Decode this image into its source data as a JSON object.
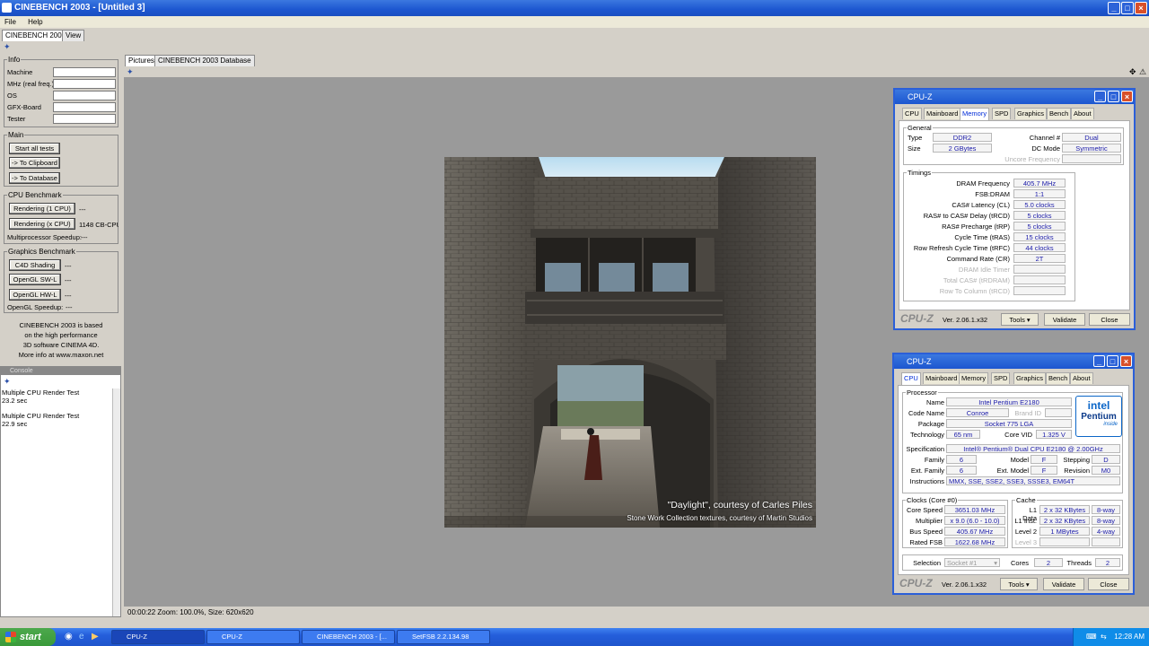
{
  "window": {
    "title": "CINEBENCH 2003 - [Untitled 3]"
  },
  "menu": {
    "file": "File",
    "help": "Help"
  },
  "tabs": {
    "main": "CINEBENCH 2003",
    "view": "View",
    "pictures": "Pictures",
    "database": "CINEBENCH 2003 Database"
  },
  "info": {
    "title": "Info",
    "machine": "Machine",
    "mhz": "MHz (real freq.)",
    "os": "OS",
    "gfx": "GFX-Board",
    "tester": "Tester"
  },
  "main": {
    "title": "Main",
    "start": "Start all tests",
    "clipboard": "-> To Clipboard",
    "database": "-> To Database"
  },
  "cpu_bench": {
    "title": "CPU Benchmark",
    "r1": "Rendering (1 CPU)",
    "r1_val": "---",
    "rx": "Rendering (x CPU)",
    "rx_val": "1148 CB-CPU",
    "speedup": "Multiprocessor Speedup:",
    "speedup_val": "---"
  },
  "gfx_bench": {
    "title": "Graphics Benchmark",
    "c4d": "C4D Shading",
    "c4d_val": "---",
    "sw": "OpenGL SW-L",
    "sw_val": "---",
    "hw": "OpenGL HW-L",
    "hw_val": "---",
    "speedup": "OpenGL Speedup:",
    "speedup_val": "---"
  },
  "about": {
    "l1": "CINEBENCH 2003 is based",
    "l2": "on the high performance",
    "l3": "3D software CINEMA 4D.",
    "l4": "More info at www.maxon.net"
  },
  "console": {
    "title": "Console",
    "l1": "Multiple CPU Render Test",
    "l2": "23.2 sec",
    "l3": "Multiple CPU Render Test",
    "l4": "22.9 sec"
  },
  "render": {
    "caption1": "\"Daylight\", courtesy of Carles Piles",
    "caption2": "Stone Work Collection textures, courtesy of Martin Studios"
  },
  "status": {
    "text": "00:00:22  Zoom: 100.0%, Size: 620x620"
  },
  "cpuz_mem": {
    "title": "CPU-Z",
    "tabs": [
      "CPU",
      "Mainboard",
      "Memory",
      "SPD",
      "Graphics",
      "Bench",
      "About"
    ],
    "general": "General",
    "type_l": "Type",
    "type": "DDR2",
    "size_l": "Size",
    "size": "2 GBytes",
    "channel_l": "Channel #",
    "channel": "Dual",
    "dc_l": "DC Mode",
    "dc": "Symmetric",
    "uncore_l": "Uncore Frequency",
    "timings": "Timings",
    "t": [
      {
        "l": "DRAM Frequency",
        "v": "405.7 MHz"
      },
      {
        "l": "FSB:DRAM",
        "v": "1:1"
      },
      {
        "l": "CAS# Latency (CL)",
        "v": "5.0 clocks"
      },
      {
        "l": "RAS# to CAS# Delay (tRCD)",
        "v": "5 clocks"
      },
      {
        "l": "RAS# Precharge (tRP)",
        "v": "5 clocks"
      },
      {
        "l": "Cycle Time (tRAS)",
        "v": "15 clocks"
      },
      {
        "l": "Row Refresh Cycle Time (tRFC)",
        "v": "44 clocks"
      },
      {
        "l": "Command Rate (CR)",
        "v": "2T"
      },
      {
        "l": "DRAM Idle Timer",
        "v": ""
      },
      {
        "l": "Total CAS# (tRDRAM)",
        "v": ""
      },
      {
        "l": "Row To Column (tRCD)",
        "v": ""
      }
    ],
    "brand": "CPU-Z",
    "ver": "Ver. 2.06.1.x32",
    "tools": "Tools",
    "validate": "Validate",
    "close": "Close"
  },
  "cpuz_cpu": {
    "title": "CPU-Z",
    "tabs": [
      "CPU",
      "Mainboard",
      "Memory",
      "SPD",
      "Graphics",
      "Bench",
      "About"
    ],
    "processor": "Processor",
    "name_l": "Name",
    "name": "Intel Pentium E2180",
    "code_l": "Code Name",
    "code": "Conroe",
    "brandid_l": "Brand ID",
    "pkg_l": "Package",
    "pkg": "Socket 775 LGA",
    "tech_l": "Technology",
    "tech": "65 nm",
    "vid_l": "Core VID",
    "vid": "1.325 V",
    "spec_l": "Specification",
    "spec": "Intel® Pentium® Dual  CPU  E2180  @ 2.00GHz",
    "fam_l": "Family",
    "fam": "6",
    "model_l": "Model",
    "model": "F",
    "step_l": "Stepping",
    "step": "D",
    "efam_l": "Ext. Family",
    "efam": "6",
    "emodel_l": "Ext. Model",
    "emodel": "F",
    "rev_l": "Revision",
    "rev": "M0",
    "instr_l": "Instructions",
    "instr": "MMX, SSE, SSE2, SSE3, SSSE3, EM64T",
    "clocks": "Clocks (Core #0)",
    "cs_l": "Core Speed",
    "cs": "3651.03 MHz",
    "mul_l": "Multiplier",
    "mul": "x 9.0 (6.0 - 10.0)",
    "bus_l": "Bus Speed",
    "bus": "405.67 MHz",
    "fsb_l": "Rated FSB",
    "fsb": "1622.68 MHz",
    "cache": "Cache",
    "l1d_l": "L1 Data",
    "l1d": "2 x 32 KBytes",
    "l1d_w": "8-way",
    "l1i_l": "L1 Inst.",
    "l1i": "2 x 32 KBytes",
    "l1i_w": "8-way",
    "l2_l": "Level 2",
    "l2": "1 MBytes",
    "l2_w": "4-way",
    "l3_l": "Level 3",
    "sel_l": "Selection",
    "sel": "Socket #1",
    "cores_l": "Cores",
    "cores": "2",
    "threads_l": "Threads",
    "threads": "2",
    "logo_intel": "intel",
    "logo_pentium": "Pentium",
    "logo_inside": "inside",
    "brand": "CPU-Z",
    "ver": "Ver. 2.06.1.x32",
    "tools": "Tools",
    "validate": "Validate",
    "close": "Close"
  },
  "taskbar": {
    "start": "start",
    "items": [
      "CPU-Z",
      "CPU-Z",
      "CINEBENCH 2003 - [...",
      "SetFSB 2.2.134.98"
    ],
    "time": "12:28 AM"
  }
}
